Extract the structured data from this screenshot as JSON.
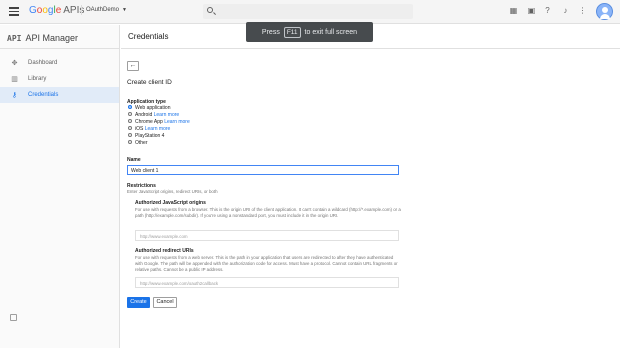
{
  "topbar": {
    "brand_google": [
      "G",
      "o",
      "o",
      "g",
      "l",
      "e"
    ],
    "brand_apis": "APIs",
    "project": "OAuthDemo",
    "icons": [
      "hamburger-icon",
      "search-icon",
      "apps-icon",
      "feedback-icon",
      "help-icon",
      "notifications-icon",
      "more-icon",
      "account-avatar"
    ]
  },
  "toast": {
    "prefix": "Press",
    "key": "F11",
    "suffix": "to exit full screen"
  },
  "sidebar": {
    "api_mark": "API",
    "title": "API Manager",
    "items": [
      {
        "label": "Dashboard",
        "icon": "dashboard-icon",
        "glyph": "✥"
      },
      {
        "label": "Library",
        "icon": "library-icon",
        "glyph": "▥"
      },
      {
        "label": "Credentials",
        "icon": "key-icon",
        "glyph": "⚷"
      }
    ],
    "active_index": 2
  },
  "main": {
    "page_title": "Credentials",
    "back_glyph": "←",
    "form_title": "Create client ID",
    "app_type_label": "Application type",
    "app_types": [
      {
        "label": "Web application",
        "link": "",
        "selected": true
      },
      {
        "label": "Android",
        "link": "Learn more",
        "selected": false
      },
      {
        "label": "Chrome App",
        "link": "Learn more",
        "selected": false
      },
      {
        "label": "iOS",
        "link": "Learn more",
        "selected": false
      },
      {
        "label": "PlayStation 4",
        "link": "",
        "selected": false
      },
      {
        "label": "Other",
        "link": "",
        "selected": false
      }
    ],
    "name_label": "Name",
    "name_value": "Web client 1",
    "restrictions_label": "Restrictions",
    "restrictions_hint": "Enter JavaScript origins, redirect URIs, or both",
    "js_origins_label": "Authorized JavaScript origins",
    "js_origins_hint": "For use with requests from a browser. This is the origin URI of the client application. It can't contain a wildcard (http://*.example.com) or a path (http://example.com/subdir). If you're using a nonstandard port, you must include it in the origin URI.",
    "js_origins_placeholder": "http://www.example.com",
    "redirect_label": "Authorized redirect URIs",
    "redirect_hint": "For use with requests from a web server. This is the path in your application that users are redirected to after they have authenticated with Google. The path will be appended with the authorization code for access. Must have a protocol. Cannot contain URL fragments or relative paths. Cannot be a public IP address.",
    "redirect_placeholder": "http://www.example.com/oauth2callback",
    "create_label": "Create",
    "cancel_label": "Cancel"
  },
  "colors": {
    "accent": "#1a73e8",
    "active_bg": "#e1ebf8",
    "toast_bg": "#3c4043"
  }
}
